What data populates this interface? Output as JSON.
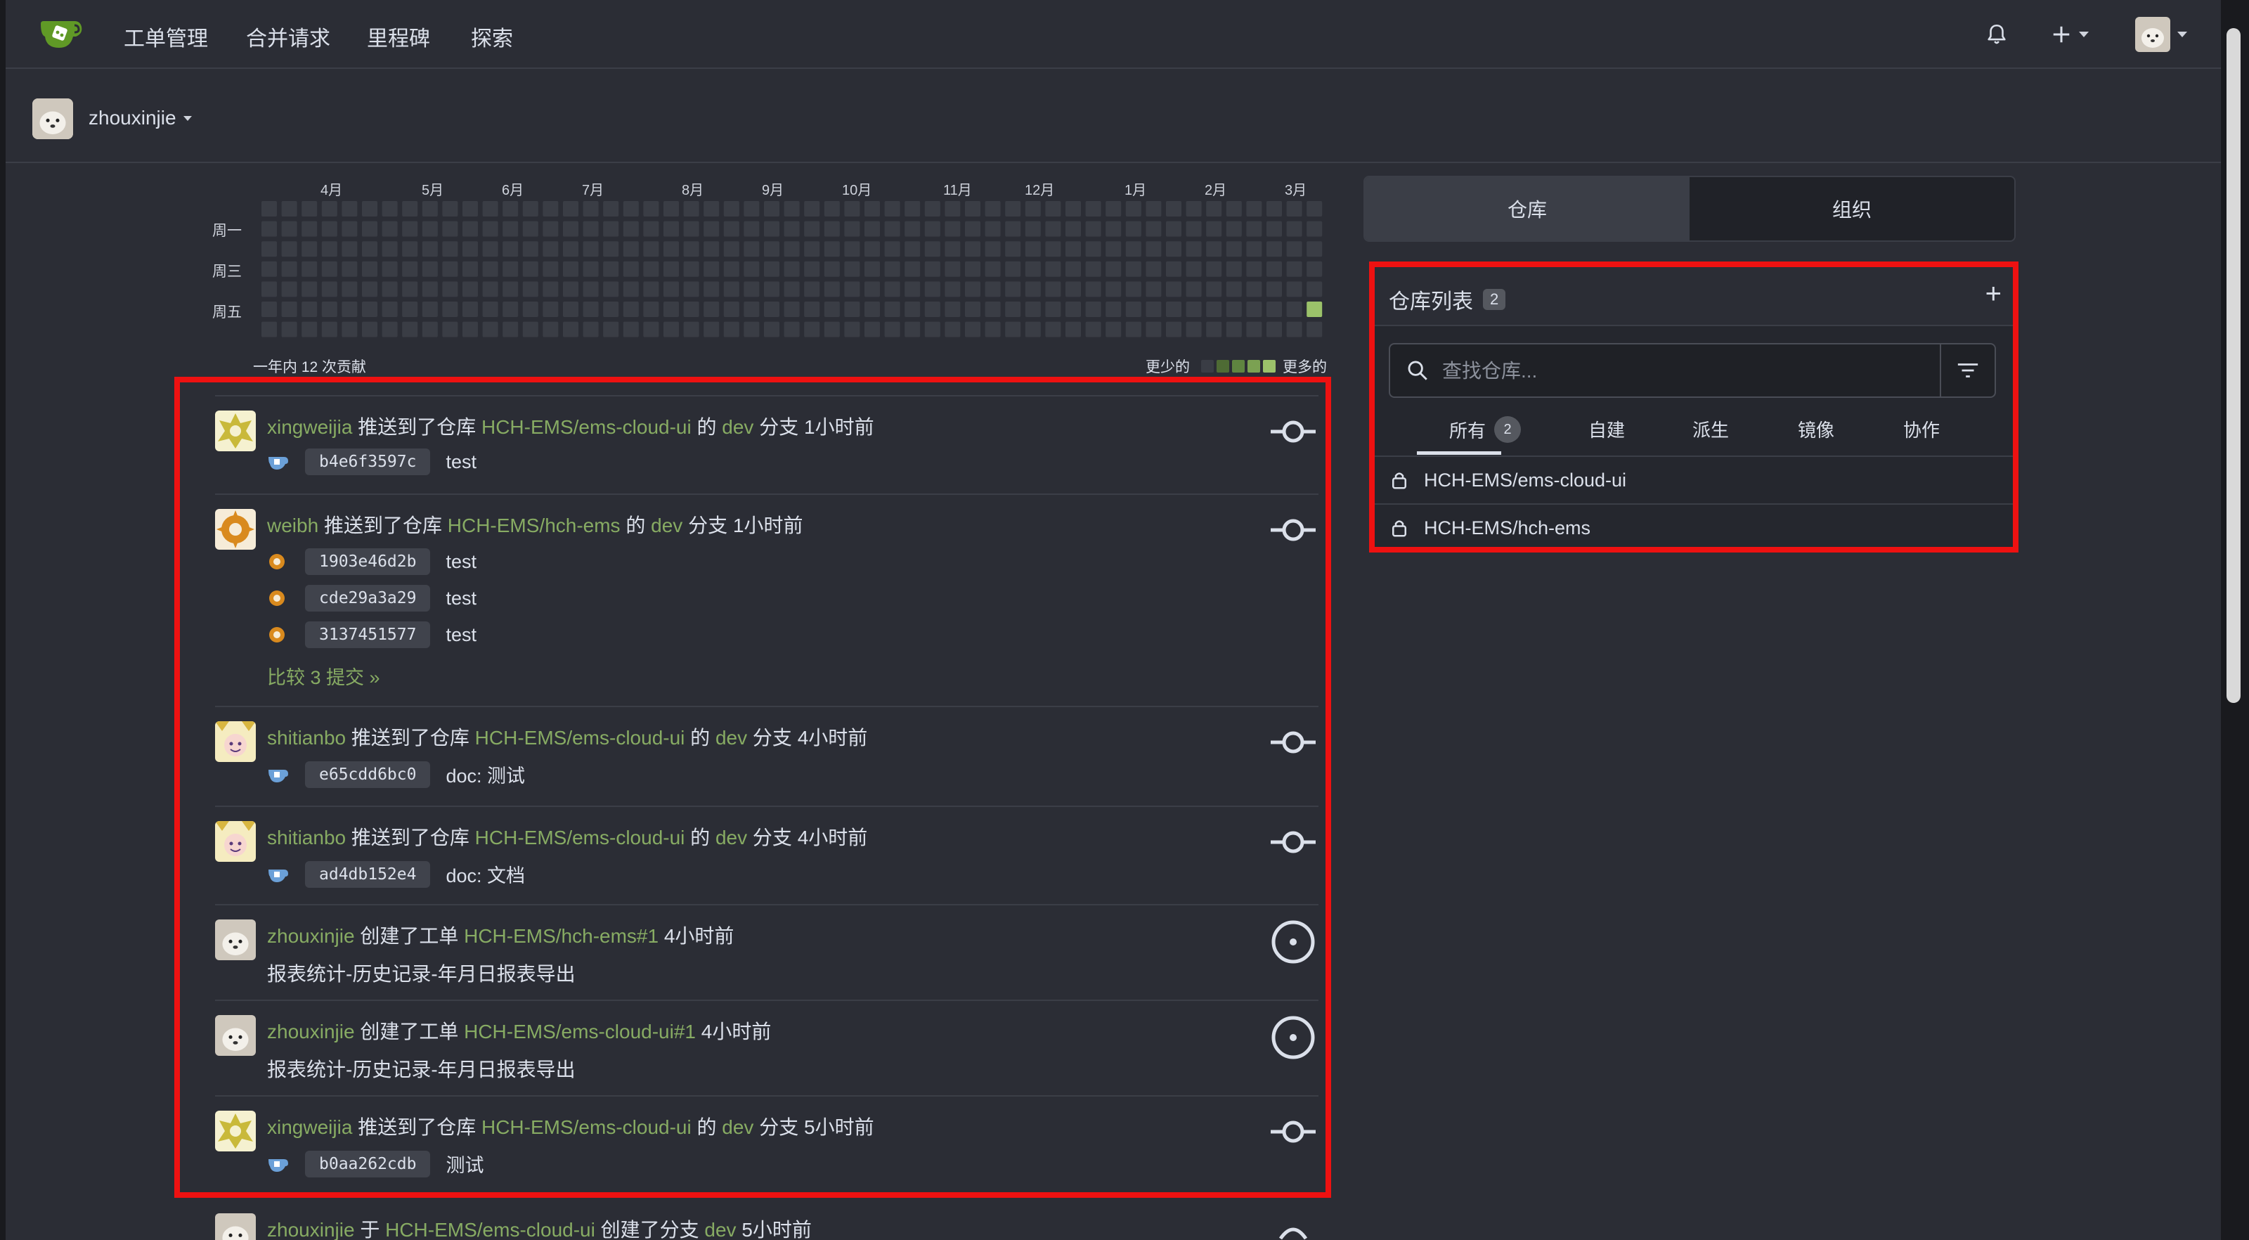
{
  "nav": {
    "items": [
      "工单管理",
      "合并请求",
      "里程碑",
      "探索"
    ]
  },
  "user": {
    "name": "zhouxinjie"
  },
  "heatmap": {
    "months": [
      "4月",
      "5月",
      "6月",
      "7月",
      "8月",
      "9月",
      "10月",
      "11月",
      "12月",
      "1月",
      "2月",
      "3月"
    ],
    "weekdays": [
      "周一",
      "周三",
      "周五"
    ],
    "summary": "一年内 12 次贡献",
    "legend_less": "更少的",
    "legend_more": "更多的",
    "colors": [
      "#3a3d45",
      "#4e6b34",
      "#5f8540",
      "#7ba152",
      "#9bc26a"
    ]
  },
  "feed": [
    {
      "user": "xingweijia",
      "action": "推送到了仓库",
      "repo": "HCH-EMS/ems-cloud-ui",
      "of": "的",
      "branch": "dev",
      "branch_suffix": "分支",
      "time": "1小时前",
      "commits": [
        {
          "sha": "b4e6f3597c",
          "msg": "test"
        }
      ]
    },
    {
      "user": "weibh",
      "action": "推送到了仓库",
      "repo": "HCH-EMS/hch-ems",
      "of": "的",
      "branch": "dev",
      "branch_suffix": "分支",
      "time": "1小时前",
      "commits": [
        {
          "sha": "1903e46d2b",
          "msg": "test"
        },
        {
          "sha": "cde29a3a29",
          "msg": "test"
        },
        {
          "sha": "3137451577",
          "msg": "test"
        }
      ],
      "compare": "比较 3 提交 »"
    },
    {
      "user": "shitianbo",
      "action": "推送到了仓库",
      "repo": "HCH-EMS/ems-cloud-ui",
      "of": "的",
      "branch": "dev",
      "branch_suffix": "分支",
      "time": "4小时前",
      "commits": [
        {
          "sha": "e65cdd6bc0",
          "msg": "doc: 测试"
        }
      ]
    },
    {
      "user": "shitianbo",
      "action": "推送到了仓库",
      "repo": "HCH-EMS/ems-cloud-ui",
      "of": "的",
      "branch": "dev",
      "branch_suffix": "分支",
      "time": "4小时前",
      "commits": [
        {
          "sha": "ad4db152e4",
          "msg": "doc: 文档"
        }
      ]
    },
    {
      "user": "zhouxinjie",
      "action": "创建了工单",
      "repo": "HCH-EMS/hch-ems#1",
      "time": "4小时前",
      "body": "报表统计-历史记录-年月日报表导出"
    },
    {
      "user": "zhouxinjie",
      "action": "创建了工单",
      "repo": "HCH-EMS/ems-cloud-ui#1",
      "time": "4小时前",
      "body": "报表统计-历史记录-年月日报表导出"
    },
    {
      "user": "xingweijia",
      "action": "推送到了仓库",
      "repo": "HCH-EMS/ems-cloud-ui",
      "of": "的",
      "branch": "dev",
      "branch_suffix": "分支",
      "time": "5小时前",
      "commits": [
        {
          "sha": "b0aa262cdb",
          "msg": "测试"
        }
      ]
    },
    {
      "user": "zhouxinjie",
      "action": "于",
      "repo": "HCH-EMS/ems-cloud-ui",
      "of": "创建了分支",
      "branch": "dev",
      "time": "5小时前"
    }
  ],
  "right": {
    "tabs": [
      "仓库",
      "组织"
    ],
    "repo_list_title": "仓库列表",
    "repo_count": "2",
    "plus": "+",
    "search_placeholder": "查找仓库...",
    "subtabs": [
      {
        "label": "所有",
        "count": "2"
      },
      {
        "label": "自建"
      },
      {
        "label": "派生"
      },
      {
        "label": "镜像"
      },
      {
        "label": "协作"
      }
    ],
    "repos": [
      "HCH-EMS/ems-cloud-ui",
      "HCH-EMS/hch-ems"
    ]
  }
}
